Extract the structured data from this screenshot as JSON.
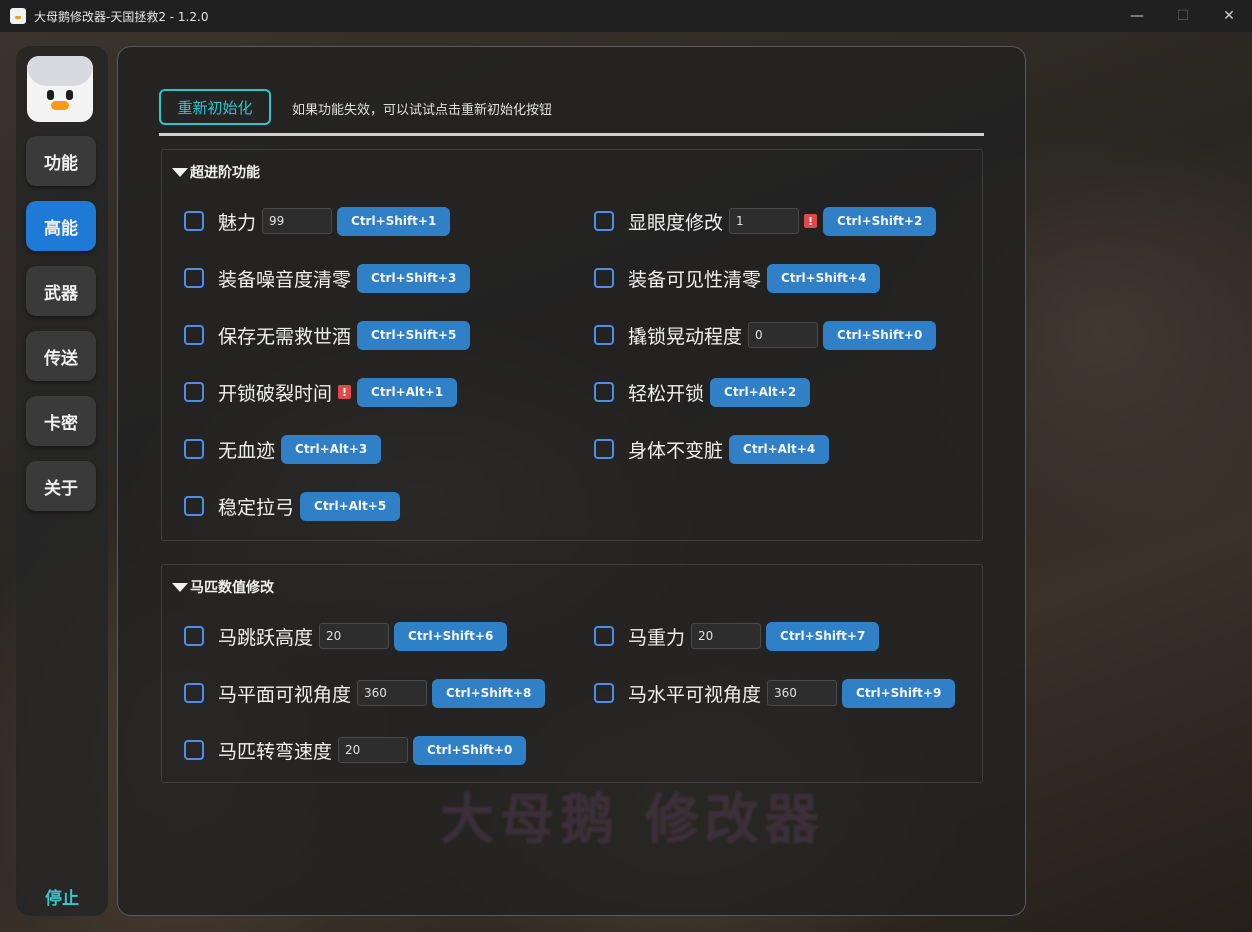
{
  "window": {
    "title": "大母鹅修改器-天国拯救2 - 1.2.0",
    "minimize": "—",
    "maximize": "☐",
    "close": "✕"
  },
  "sidebar": {
    "items": [
      {
        "label": "功能",
        "active": false
      },
      {
        "label": "高能",
        "active": true
      },
      {
        "label": "武器",
        "active": false
      },
      {
        "label": "传送",
        "active": false
      },
      {
        "label": "卡密",
        "active": false
      },
      {
        "label": "关于",
        "active": false
      }
    ],
    "stop_label": "停止"
  },
  "main": {
    "reinit_label": "重新初始化",
    "hint": "如果功能失效，可以试试点击重新初始化按钮",
    "watermark": "大母鹅 修改器",
    "sections": [
      {
        "title": "超进阶功能",
        "items": [
          {
            "label": "魅力",
            "value": "99",
            "warn": false,
            "key": "Ctrl+Shift+1"
          },
          {
            "label": "显眼度修改",
            "value": "1",
            "warn": true,
            "key": "Ctrl+Shift+2"
          },
          {
            "label": "装备噪音度清零",
            "value": null,
            "warn": false,
            "key": "Ctrl+Shift+3"
          },
          {
            "label": "装备可见性清零",
            "value": null,
            "warn": false,
            "key": "Ctrl+Shift+4"
          },
          {
            "label": "保存无需救世酒",
            "value": null,
            "warn": false,
            "key": "Ctrl+Shift+5"
          },
          {
            "label": "撬锁晃动程度",
            "value": "0",
            "warn": false,
            "key": "Ctrl+Shift+0"
          },
          {
            "label": "开锁破裂时间",
            "value": null,
            "warn": true,
            "key": "Ctrl+Alt+1"
          },
          {
            "label": "轻松开锁",
            "value": null,
            "warn": false,
            "key": "Ctrl+Alt+2"
          },
          {
            "label": "无血迹",
            "value": null,
            "warn": false,
            "key": "Ctrl+Alt+3"
          },
          {
            "label": "身体不变脏",
            "value": null,
            "warn": false,
            "key": "Ctrl+Alt+4"
          },
          {
            "label": "稳定拉弓",
            "value": null,
            "warn": false,
            "key": "Ctrl+Alt+5"
          }
        ]
      },
      {
        "title": "马匹数值修改",
        "items": [
          {
            "label": "马跳跃高度",
            "value": "20",
            "warn": false,
            "key": "Ctrl+Shift+6"
          },
          {
            "label": "马重力",
            "value": "20",
            "warn": false,
            "key": "Ctrl+Shift+7"
          },
          {
            "label": "马平面可视角度",
            "value": "360",
            "warn": false,
            "key": "Ctrl+Shift+8"
          },
          {
            "label": "马水平可视角度",
            "value": "360",
            "warn": false,
            "key": "Ctrl+Shift+9"
          },
          {
            "label": "马匹转弯速度",
            "value": "20",
            "warn": false,
            "key": "Ctrl+Shift+0"
          }
        ]
      }
    ]
  },
  "colors": {
    "accent": "#1e7ad6",
    "hotkey": "#2f80c6",
    "cyan": "#2ec5d0",
    "warning": "#e0484a"
  }
}
